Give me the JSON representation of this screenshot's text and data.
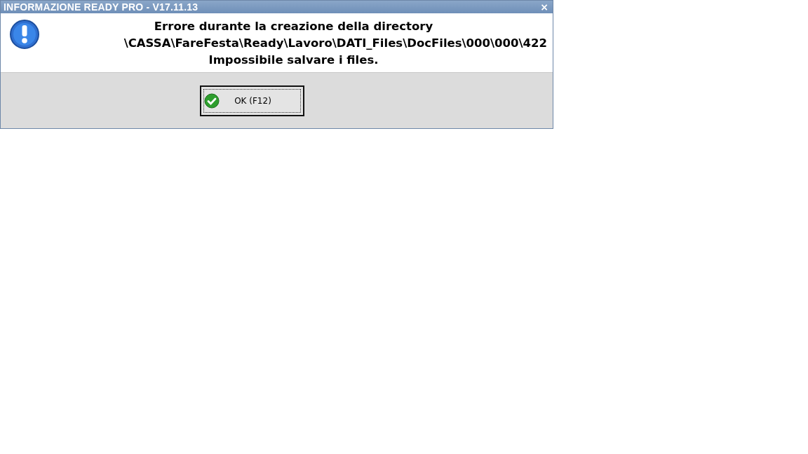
{
  "window": {
    "title": "INFORMAZIONE READY PRO - V17.11.13",
    "close": "×"
  },
  "message": [
    "Errore durante la creazione della directory",
    "\\CASSA\\FareFesta\\Ready\\Lavoro\\DATI_Files\\DocFiles\\000\\000\\422",
    "Impossibile salvare i files."
  ],
  "buttons": [
    {
      "label": "OK (F12)",
      "focused": true
    }
  ]
}
